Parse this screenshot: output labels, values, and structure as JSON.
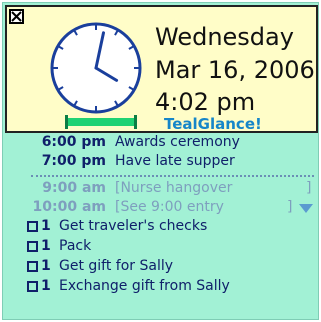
{
  "header": {
    "weekday": "Wednesday",
    "date": "Mar 16, 2006",
    "time": "4:02 pm",
    "brand": "TealGlance!",
    "progress": 1.0
  },
  "clock": {
    "hour": 4,
    "minute": 2
  },
  "appointments": [
    {
      "time": "6:00 pm",
      "desc": "Awards ceremony",
      "state": "normal"
    },
    {
      "time": "7:00 pm",
      "desc": "Have late supper",
      "state": "normal"
    }
  ],
  "upcoming": [
    {
      "time": "9:00 am",
      "desc": "[Nurse hangover",
      "close": "]"
    },
    {
      "time": "10:00 am",
      "desc": "[See 9:00 entry",
      "close": "]"
    }
  ],
  "todos": [
    {
      "priority": "1",
      "task": "Get traveler's checks",
      "checked": false
    },
    {
      "priority": "1",
      "task": "Pack",
      "checked": false
    },
    {
      "priority": "1",
      "task": "Get gift for Sally",
      "checked": false
    },
    {
      "priority": "1",
      "task": "Exchange gift from Sally",
      "checked": false
    }
  ],
  "icons": {
    "close": "close-box-icon",
    "clock": "analog-clock-icon",
    "scroll": "scroll-down-arrow-icon"
  },
  "colors": {
    "background": "#a2f1d5",
    "header": "#fffdc8",
    "brand": "#1686c9",
    "text": "#10206a",
    "muted": "#7e9fbe",
    "progress": "#1fd273"
  }
}
